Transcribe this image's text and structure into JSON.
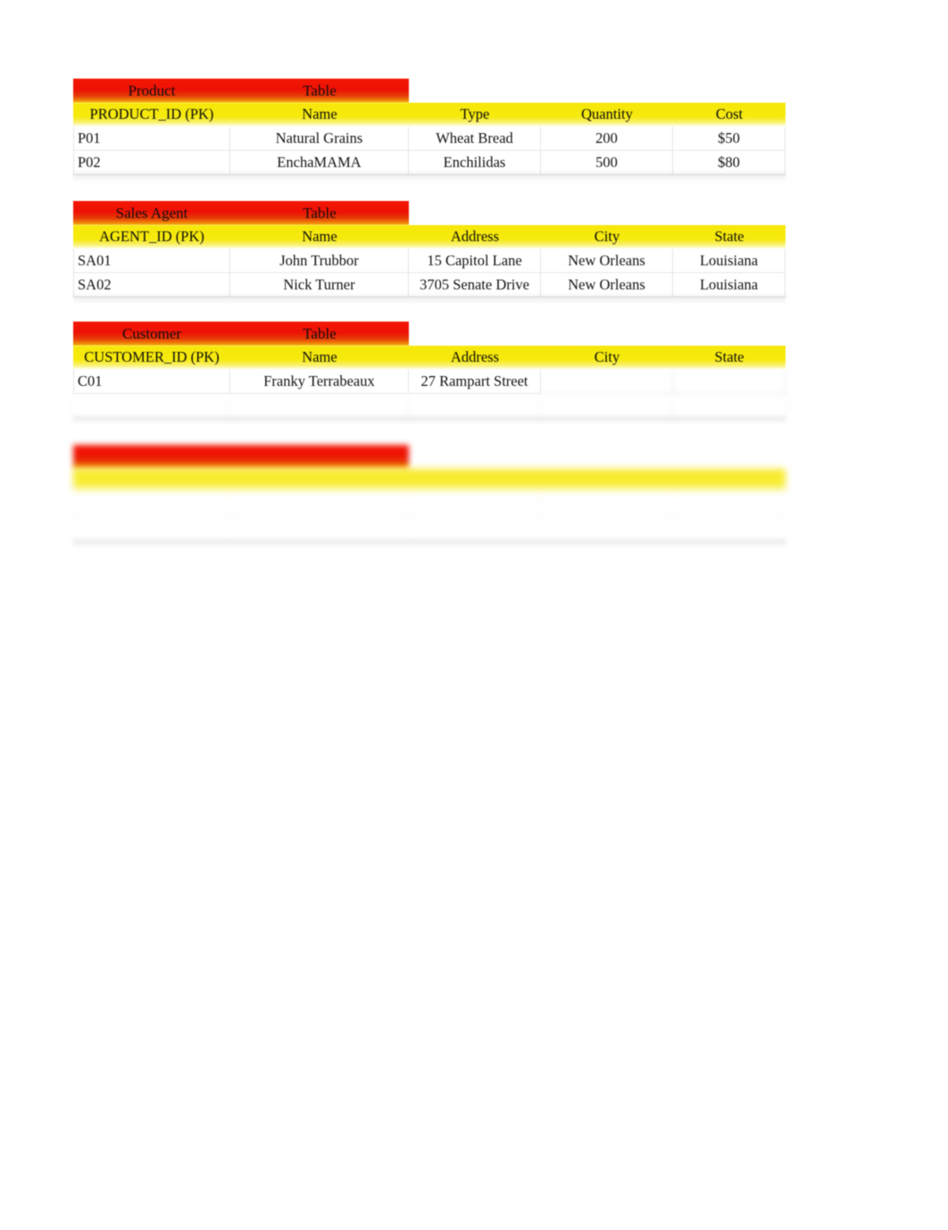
{
  "document": {
    "background_color": "#ffffff",
    "title_bar_color": "#ee1105",
    "header_row_color": "#f7e70a",
    "text_color": "#121212"
  },
  "tables": [
    {
      "title": {
        "entity": "Product",
        "suffix": "Table"
      },
      "columns": [
        "PRODUCT_ID (PK)",
        "Name",
        "Type",
        "Quantity",
        "Cost"
      ],
      "rows": [
        [
          "P01",
          "Natural Grains",
          "Wheat Bread",
          "200",
          "$50"
        ],
        [
          "P02",
          "EnchaMAMA",
          "Enchilidas",
          "500",
          "$80"
        ]
      ],
      "legibility": [
        "clear",
        "clear"
      ]
    },
    {
      "title": {
        "entity": "Sales Agent",
        "suffix": "Table"
      },
      "columns": [
        "AGENT_ID (PK)",
        "Name",
        "Address",
        "City",
        "State"
      ],
      "rows": [
        [
          "SA01",
          "John Trubbor",
          "15 Capitol Lane",
          "New Orleans",
          "Louisiana"
        ],
        [
          "SA02",
          "Nick Turner",
          "3705 Senate Drive",
          "New Orleans",
          "Louisiana"
        ]
      ],
      "legibility": [
        "clear",
        "clear"
      ]
    },
    {
      "title": {
        "entity": "Customer",
        "suffix": "Table"
      },
      "columns": [
        "CUSTOMER_ID (PK)",
        "Name",
        "Address",
        "City",
        "State"
      ],
      "rows": [
        [
          "C01",
          "Franky Terrabeaux",
          "27 Rampart Street",
          "",
          ""
        ],
        [
          "",
          "",
          "",
          "",
          ""
        ]
      ],
      "legibility": [
        "partially-faded",
        "illegible"
      ]
    },
    {
      "title": {
        "entity": "",
        "suffix": ""
      },
      "columns": [
        "",
        "",
        "",
        "",
        ""
      ],
      "rows": [
        [
          "",
          "",
          "",
          "",
          ""
        ],
        [
          "",
          "",
          "",
          "",
          ""
        ]
      ],
      "legibility": [
        "illegible",
        "illegible"
      ]
    }
  ]
}
